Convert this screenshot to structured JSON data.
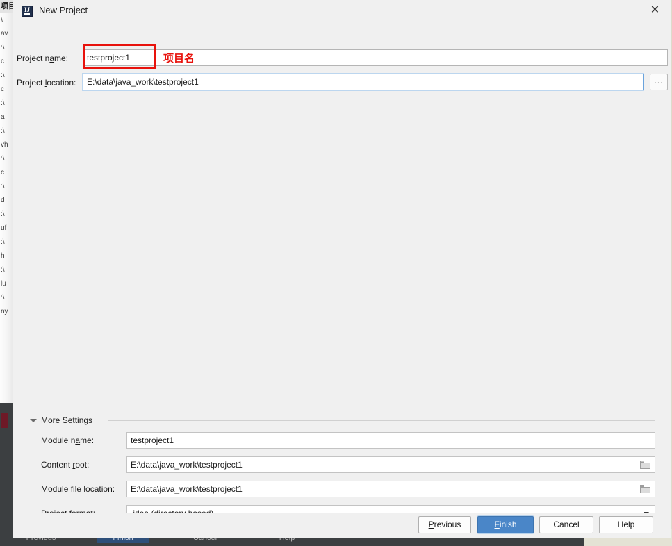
{
  "background": {
    "left_panel_title": "项目",
    "left_lines": [
      "\\",
      "av",
      ":\\",
      "c",
      ":\\",
      "c",
      ":\\",
      "a",
      ":\\",
      "vh",
      ":\\",
      "c",
      ":\\",
      "d",
      ":\\",
      "uf",
      ":\\",
      "h",
      ":\\",
      "lu",
      ":\\",
      "ny"
    ],
    "right_rows": [
      "",
      "",
      "",
      "",
      "",
      "",
      "",
      "",
      "",
      "",
      "",
      "",
      "",
      "",
      "",
      "",
      ""
    ],
    "bottom_dialog_buttons": [
      "Previous",
      "Finish",
      "Cancel",
      "Help"
    ]
  },
  "window": {
    "title": "New Project",
    "icon": "intellij-idea-icon",
    "close_label": "✕"
  },
  "form": {
    "project_name": {
      "label_pre": "Project n",
      "label_mnemonic": "a",
      "label_post": "me:",
      "value": "testproject1"
    },
    "project_location": {
      "label_pre": "Project ",
      "label_mnemonic": "l",
      "label_post": "ocation:",
      "value": "E:\\data\\java_work\\testproject1"
    },
    "browse_button_label": "...",
    "annotation": {
      "text": "项目名",
      "color": "#e8120c"
    }
  },
  "more_settings": {
    "header_pre": "Mor",
    "header_mnemonic": "e",
    "header_post": " Settings",
    "rows": [
      {
        "label_pre": "Module n",
        "label_mnemonic": "a",
        "label_post": "me:",
        "value": "testproject1",
        "widget": "text"
      },
      {
        "label_pre": "Content ",
        "label_mnemonic": "r",
        "label_post": "oot:",
        "value": "E:\\data\\java_work\\testproject1",
        "widget": "folder"
      },
      {
        "label_pre": "Mod",
        "label_mnemonic": "u",
        "label_post": "le file location:",
        "value": "E:\\data\\java_work\\testproject1",
        "widget": "folder"
      },
      {
        "label_pre": "Project ",
        "label_mnemonic": "f",
        "label_post": "ormat:",
        "value": ".idea (directory based)",
        "widget": "combo"
      }
    ]
  },
  "footer": {
    "previous": {
      "pre": "",
      "mnemonic": "P",
      "post": "revious"
    },
    "finish": {
      "pre": "",
      "mnemonic": "F",
      "post": "inish"
    },
    "cancel": {
      "pre": "",
      "mnemonic": "",
      "post": "Cancel"
    },
    "help": {
      "pre": "",
      "mnemonic": "",
      "post": "Help"
    }
  },
  "colors": {
    "accent": "#4a86c8",
    "annotation": "#e8120c",
    "dialog_bg": "#f0f0f0"
  }
}
